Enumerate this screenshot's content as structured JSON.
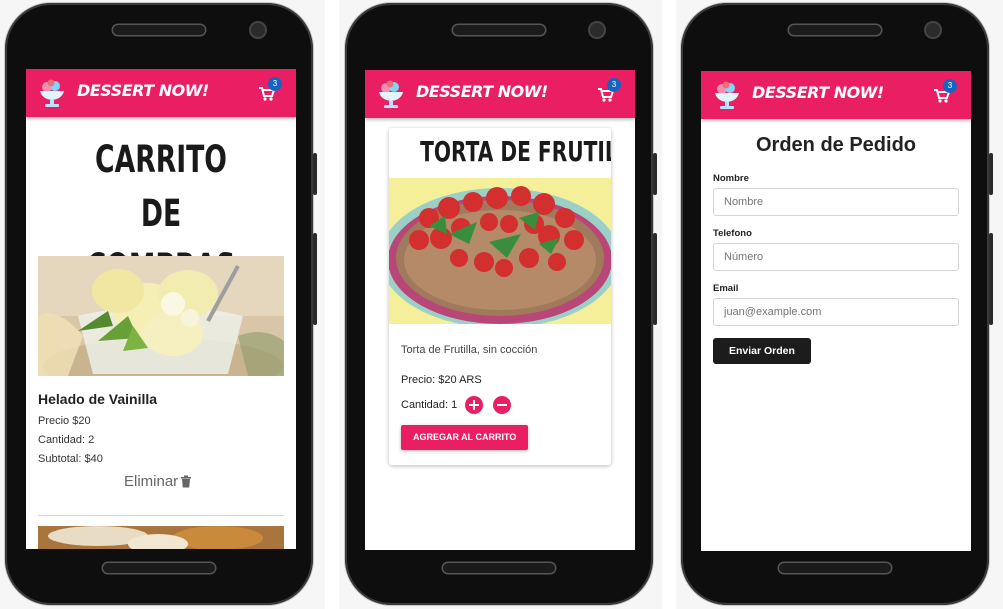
{
  "app": {
    "brand": "DESSERT NOW!",
    "cart_count": "3",
    "colors": {
      "primary": "#e91e63",
      "badge": "#1565c0",
      "dark_button": "#1c1c1c"
    }
  },
  "cart_screen": {
    "title": "CARRITO DE COMPRAS",
    "item": {
      "name": "Helado de Vainilla",
      "price": "Precio $20",
      "quantity": "Cantidad: 2",
      "subtotal": "Subtotal: $40",
      "remove_label": "Eliminar"
    }
  },
  "product_screen": {
    "title": "TORTA DE FRUTILLAS",
    "description": "Torta de Frutilla, sin cocción",
    "price": "Precio: $20 ARS",
    "quantity_label": "Cantidad: 1",
    "add_button": "AGREGAR AL CARRITO"
  },
  "order_screen": {
    "title": "Orden de Pedido",
    "fields": [
      {
        "label": "Nombre",
        "placeholder": "Nombre"
      },
      {
        "label": "Telefono",
        "placeholder": "Número"
      },
      {
        "label": "Email",
        "placeholder": "juan@example.com"
      }
    ],
    "submit": "Enviar Orden"
  }
}
